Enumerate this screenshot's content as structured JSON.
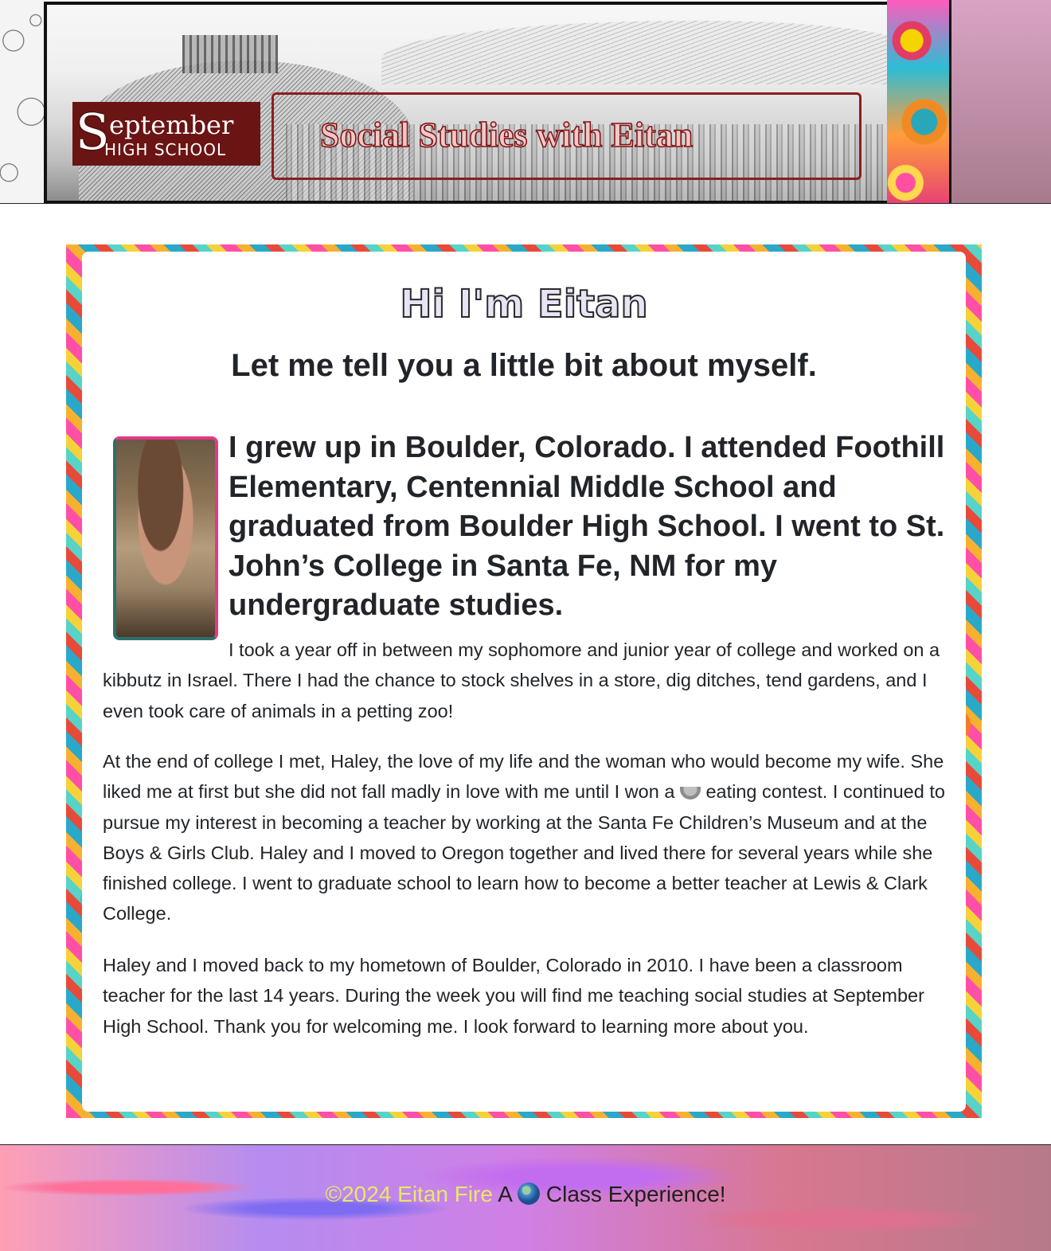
{
  "header": {
    "logo_initial": "S",
    "logo_word1": "eptember",
    "logo_word2": "HIGH SCHOOL",
    "banner_title": "Social Studies with Eitan"
  },
  "main": {
    "title": "Hi I'm Eitan",
    "subtitle": "Let me tell you a little bit about myself.",
    "intro": "I grew up in Boulder, Colorado. I attended Foothill Elementary, Centennial Middle School and graduated from Boulder High School. I went to St. John’s College in Santa Fe, NM for my undergraduate studies.",
    "paragraph1": "I took a year off in between my sophomore and junior year of college and worked on a kibbutz in Israel. There I had the chance to stock shelves in a store, dig ditches, tend gardens, and I even took care of animals in a petting zoo!",
    "paragraph2_a": "At the end of college I met, Haley, the love of my life and the woman who would become my wife. She liked me at first but she did not fall madly in love with me until I won a ",
    "paragraph2_icon": "bowl-icon",
    "paragraph2_b": " eating contest. I continued to pursue my interest in becoming a teacher by working at the Santa Fe Children’s Museum and at the Boys & Girls Club. Haley and I moved to Oregon together and lived there for several years while she finished college. I went to graduate school to learn how to become a better teacher at Lewis & Clark College.",
    "paragraph3": "Haley and I moved back to my hometown of Boulder, Colorado in 2010. I have been a classroom teacher for the last 14 years. During the week you will find me teaching social studies at September High School. Thank you for welcoming me. I look forward to learning more about you."
  },
  "footer": {
    "credit": "©2024 Eitan Fire",
    "text_a": " A ",
    "icon": "globe-icon",
    "text_b": " Class Experience!"
  },
  "colors": {
    "logo_bg": "#6b1414",
    "scroll_border": "#8a1f1f",
    "text": "#212529",
    "footer_credit": "#e6e86a"
  }
}
